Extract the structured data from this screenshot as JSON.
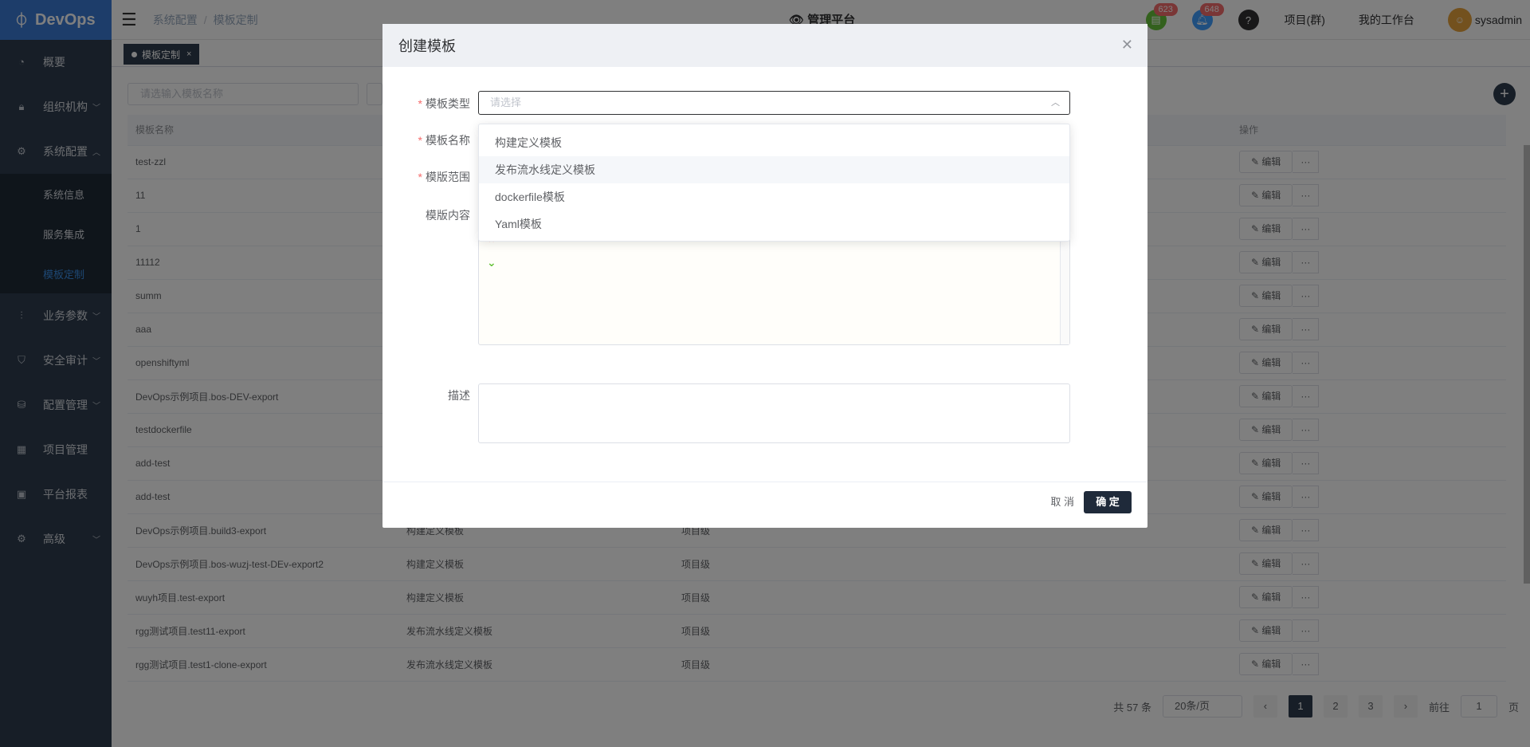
{
  "brand": {
    "name": "DevOps"
  },
  "breadcrumb": {
    "a": "系统配置",
    "b": "模板定制"
  },
  "header": {
    "center": "管理平台",
    "badge1": "623",
    "badge2": "648",
    "link_projects": "项目(群)",
    "link_workbench": "我的工作台",
    "user": "sysadmin"
  },
  "sidebar": {
    "items": [
      {
        "label": "概要"
      },
      {
        "label": "组织机构"
      },
      {
        "label": "系统配置"
      },
      {
        "label": "业务参数"
      },
      {
        "label": "安全审计"
      },
      {
        "label": "配置管理"
      },
      {
        "label": "项目管理"
      },
      {
        "label": "平台报表"
      },
      {
        "label": "高级"
      }
    ],
    "sub": [
      {
        "label": "系统信息"
      },
      {
        "label": "服务集成"
      },
      {
        "label": "模板定制"
      }
    ]
  },
  "tag": {
    "label": "模板定制"
  },
  "search": {
    "placeholder": "请选输入模板名称"
  },
  "table": {
    "headers": [
      "模板名称",
      "",
      "",
      "",
      "操作"
    ],
    "rows": [
      {
        "name": "test-zzl",
        "type": "",
        "scope": ""
      },
      {
        "name": "11",
        "type": "",
        "scope": ""
      },
      {
        "name": "1",
        "type": "",
        "scope": ""
      },
      {
        "name": "11112",
        "type": "",
        "scope": ""
      },
      {
        "name": "summ",
        "type": "",
        "scope": ""
      },
      {
        "name": "aaa",
        "type": "",
        "scope": ""
      },
      {
        "name": "openshiftyml",
        "type": "",
        "scope": ""
      },
      {
        "name": "DevOps示例项目.bos-DEV-export",
        "type": "",
        "scope": ""
      },
      {
        "name": "testdockerfile",
        "type": "",
        "scope": ""
      },
      {
        "name": "add-test",
        "type": "",
        "scope": ""
      },
      {
        "name": "add-test",
        "type": "",
        "scope": ""
      },
      {
        "name": "DevOps示例项目.build3-export",
        "type": "构建定义模板",
        "scope": "项目级"
      },
      {
        "name": "DevOps示例项目.bos-wuzj-test-DEv-export2",
        "type": "构建定义模板",
        "scope": "项目级"
      },
      {
        "name": "wuyh项目.test-export",
        "type": "构建定义模板",
        "scope": "项目级"
      },
      {
        "name": "rgg测试项目.test11-export",
        "type": "发布流水线定义模板",
        "scope": "项目级"
      },
      {
        "name": "rgg测试项目.test1-clone-export",
        "type": "发布流水线定义模板",
        "scope": "项目级"
      }
    ],
    "edit_label": "编辑",
    "more_label": "···"
  },
  "pager": {
    "total": "共 57 条",
    "size": "20条/页",
    "pages": [
      "1",
      "2",
      "3"
    ],
    "goto": "前往",
    "goto_value": "1",
    "page_unit": "页"
  },
  "modal": {
    "title": "创建模板",
    "label_type": "模板类型",
    "label_name": "模板名称",
    "label_scope": "模版范围",
    "label_content": "模版内容",
    "label_desc": "描述",
    "select_placeholder": "请选择",
    "cancel": "取 消",
    "ok": "确 定"
  },
  "dropdown": {
    "options": [
      "构建定义模板",
      "发布流水线定义模板",
      "dockerfile模板",
      "Yaml模板"
    ]
  }
}
